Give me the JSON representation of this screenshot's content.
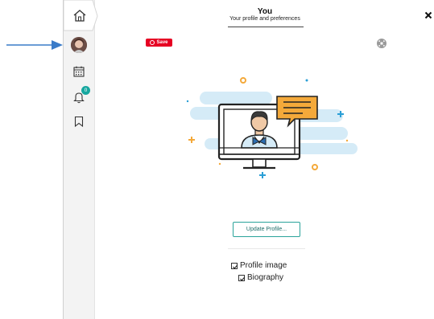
{
  "header": {
    "title": "You",
    "subtitle": "Your profile and preferences"
  },
  "toolbar": {
    "save_label": "Save"
  },
  "sidebar": {
    "items": [
      {
        "icon": "home-icon"
      },
      {
        "icon": "avatar"
      },
      {
        "icon": "calendar-icon"
      },
      {
        "icon": "bell-icon",
        "badge": "0"
      },
      {
        "icon": "bookmark-icon"
      }
    ]
  },
  "profile": {
    "update_button": "Update Profile...",
    "options": [
      {
        "label": "Profile image",
        "checked": true
      },
      {
        "label": "Biography",
        "checked": true
      }
    ]
  },
  "colors": {
    "accent": "#2aa39a",
    "save_red": "#e60023",
    "arrow_blue": "#3a7bc8",
    "illustration_blue": "#d5ebf7",
    "speech_orange": "#f4a93a"
  }
}
